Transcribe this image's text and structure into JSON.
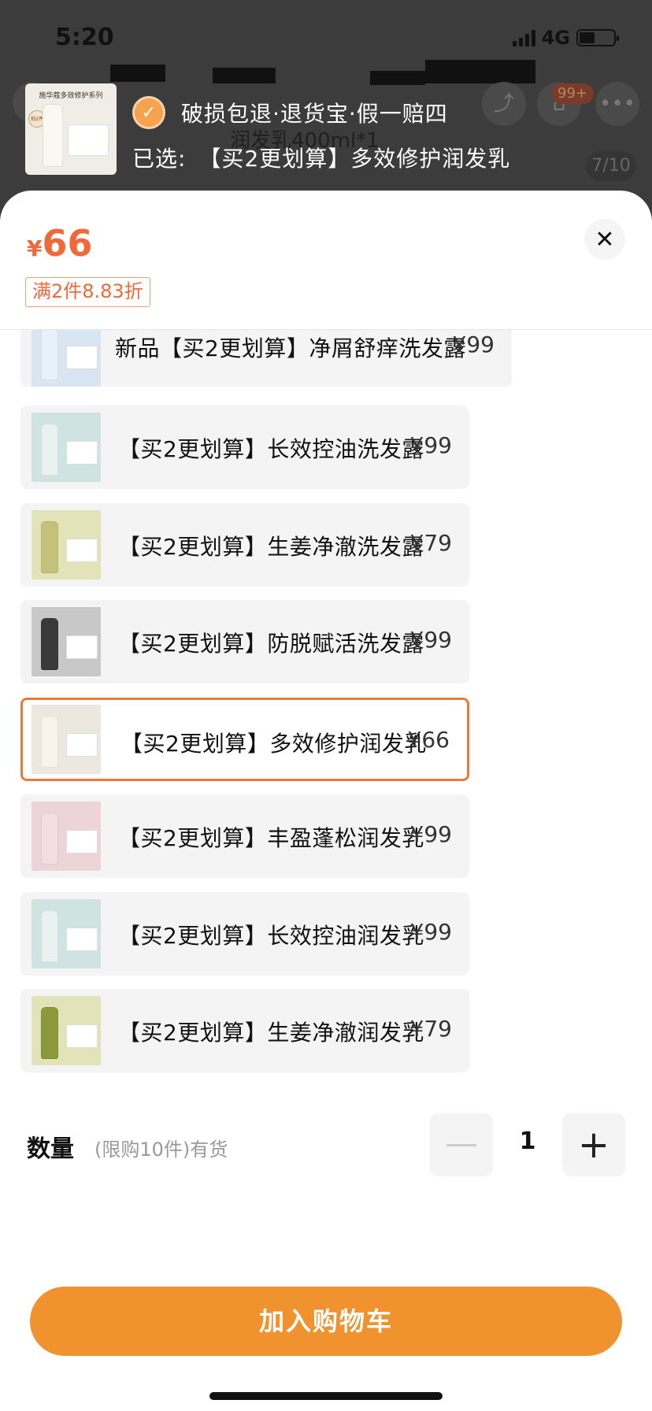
{
  "status_bar": {
    "time": "5:20",
    "network": "4G",
    "battery_level": 0.45
  },
  "background": {
    "cart_badge": "99+",
    "title_fragment": "润发乳400ml*1",
    "image_counter": "7/10"
  },
  "floating": {
    "guarantee_text": "破损包退·退货宝·假一赔四",
    "selected_label": "已选:",
    "selected_value": "【买2更划算】多效修护润发乳",
    "thumb_title": "施华蔻多效修护系列",
    "thumb_badge": "拍2件"
  },
  "sheet": {
    "currency": "¥",
    "price": "66",
    "discount_tag": "满2件8.83折",
    "close_icon": "close-icon"
  },
  "skus": [
    {
      "name": "新品【买2更划算】净屑舒痒洗发露",
      "price": "¥99",
      "color": "#d8e6f2",
      "bottle": "#e8f0f8",
      "selected": false
    },
    {
      "name": "【买2更划算】长效控油洗发露",
      "price": "¥99",
      "color": "#cfe3e0",
      "bottle": "#eaf2ef",
      "selected": false
    },
    {
      "name": "【买2更划算】生姜净澈洗发露",
      "price": "¥79",
      "color": "#e2e3b8",
      "bottle": "#c4c27a",
      "selected": false
    },
    {
      "name": "【买2更划算】防脱赋活洗发露",
      "price": "¥99",
      "color": "#c8c8c8",
      "bottle": "#3a3a3a",
      "selected": false
    },
    {
      "name": "【买2更划算】多效修护润发乳",
      "price": "¥66",
      "color": "#ece8e0",
      "bottle": "#f8f4ec",
      "selected": true
    },
    {
      "name": "【买2更划算】丰盈蓬松润发乳",
      "price": "¥99",
      "color": "#ecd4d8",
      "bottle": "#f4dde2",
      "selected": false
    },
    {
      "name": "【买2更划算】长效控油润发乳",
      "price": "¥99",
      "color": "#cfe3e0",
      "bottle": "#eaf2ef",
      "selected": false
    },
    {
      "name": "【买2更划算】生姜净澈润发乳",
      "price": "¥79",
      "color": "#e2e3b8",
      "bottle": "#8a9a3a",
      "selected": false
    }
  ],
  "quantity": {
    "label": "数量",
    "hint": "(限购10件)有货",
    "value": "1",
    "minus_icon": "minus-icon",
    "plus_icon": "plus-icon"
  },
  "cta": {
    "label": "加入购物车"
  }
}
